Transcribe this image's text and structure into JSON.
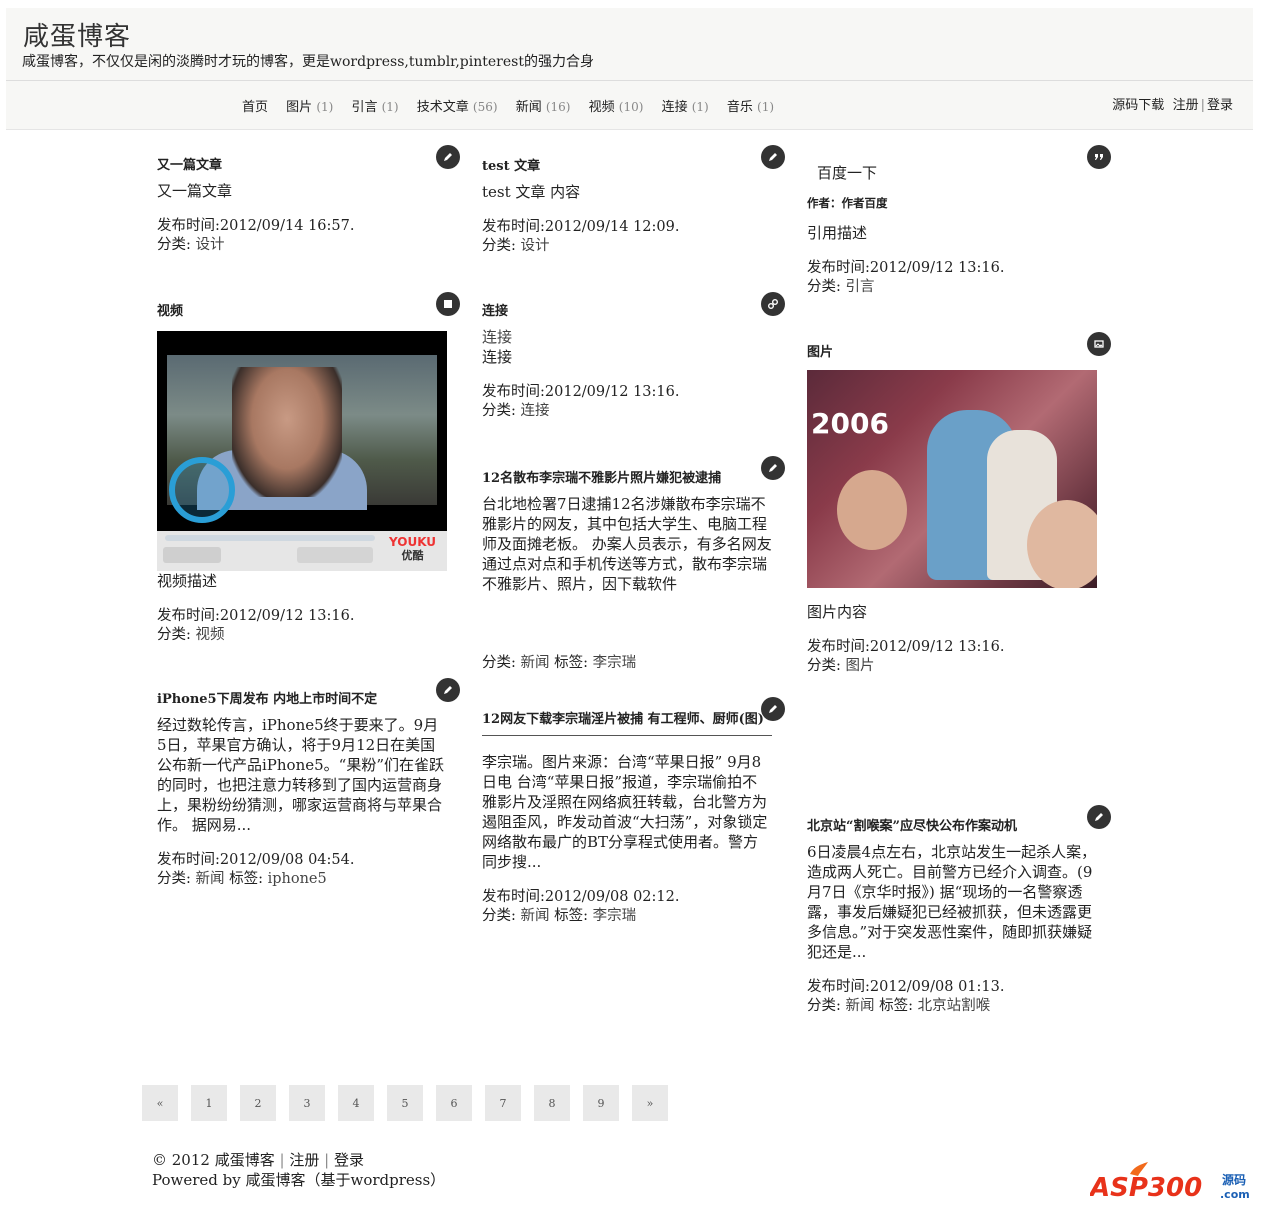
{
  "header": {
    "title": "咸蛋博客",
    "description": "咸蛋博客，不仅仅是闲的淡腾时才玩的博客，更是wordpress,tumblr,pinterest的强力合身"
  },
  "nav": {
    "items": [
      {
        "label": "首页",
        "count": ""
      },
      {
        "label": "图片",
        "count": "(1)"
      },
      {
        "label": "引言",
        "count": "(1)"
      },
      {
        "label": "技术文章",
        "count": "(56)"
      },
      {
        "label": "新闻",
        "count": "(16)"
      },
      {
        "label": "视频",
        "count": "(10)"
      },
      {
        "label": "连接",
        "count": "(1)"
      },
      {
        "label": "音乐",
        "count": "(1)"
      }
    ]
  },
  "usernav": {
    "download": "源码下载",
    "register": "注册",
    "separator": "|",
    "login": "登录"
  },
  "labels": {
    "published": "发布时间:",
    "category": "分类:",
    "tags": "标签:"
  },
  "posts": {
    "p1": {
      "title": "又一篇文章",
      "body": "又一篇文章",
      "date": "2012/09/14 16:57.",
      "category": "设计",
      "icon": "pencil-icon"
    },
    "p2": {
      "title": "test 文章",
      "body": "test 文章 内容",
      "date": "2012/09/14 12:09.",
      "category": "设计",
      "icon": "pencil-icon"
    },
    "p3": {
      "quote": "百度一下",
      "author": "作者：作者百度",
      "body": "引用描述",
      "date": "2012/09/12 13:16.",
      "category": "引言",
      "icon": "quote-icon"
    },
    "p4": {
      "title": "视频",
      "body": "视频描述",
      "date": "2012/09/12 13:16.",
      "category": "视频",
      "icon": "video-icon",
      "player_brand": "YOUKU",
      "player_brand_cn": "优酷"
    },
    "p5": {
      "title": "连接",
      "link1": "连接",
      "link2": "连接",
      "date": "2012/09/12 13:16.",
      "category": "连接",
      "icon": "link-icon"
    },
    "p6": {
      "title": "图片",
      "body": "图片内容",
      "date": "2012/09/12 13:16.",
      "category": "图片",
      "icon": "image-icon",
      "photo_text": "2006"
    },
    "p7": {
      "title": "12名散布李宗瑞不雅影片照片嫌犯被逮捕",
      "body": "台北地检署7日逮捕12名涉嫌散布李宗瑞不雅影片的网友，其中包括大学生、电脑工程师及面摊老板。 办案人员表示，有多名网友通过点对点和手机传送等方式，散布李宗瑞不雅影片、照片，因下载软件",
      "category": "新闻",
      "tag": "李宗瑞",
      "icon": "pencil-icon"
    },
    "p8": {
      "title": "iPhone5下周发布 内地上市时间不定",
      "body": "经过数轮传言，iPhone5终于要来了。9月5日，苹果官方确认，将于9月12日在美国公布新一代产品iPhone5。“果粉”们在雀跃的同时，也把注意力转移到了国内运营商身上，果粉纷纷猜测，哪家运营商将与苹果合作。 据网易...",
      "date": "2012/09/08 04:54.",
      "category": "新闻",
      "tag": "iphone5",
      "icon": "pencil-icon"
    },
    "p9": {
      "title": "12网友下载李宗瑞淫片被捕 有工程师、厨师(图)",
      "body": "李宗瑞。图片来源：台湾“苹果日报” 9月8日电 台湾“苹果日报”报道，李宗瑞偷拍不雅影片及淫照在网络疯狂转载，台北警方为遏阻歪风，昨发动首波“大扫荡”，对象锁定网络散布最广的BT分享程式使用者。警方同步搜...",
      "date": "2012/09/08 02:12.",
      "category": "新闻",
      "tag": "李宗瑞",
      "icon": "pencil-icon"
    },
    "p10": {
      "title": "北京站“割喉案”应尽快公布作案动机",
      "body": "6日凌晨4点左右，北京站发生一起杀人案，造成两人死亡。目前警方已经介入调查。(9月7日《京华时报》) 据“现场的一名警察透露，事发后嫌疑犯已经被抓获，但未透露更多信息。”对于突发恶性案件，随即抓获嫌疑犯还是...",
      "date": "2012/09/08 01:13.",
      "category": "新闻",
      "tag": "北京站割喉",
      "icon": "pencil-icon"
    }
  },
  "pager": [
    "«",
    "1",
    "2",
    "3",
    "4",
    "5",
    "6",
    "7",
    "8",
    "9",
    "»"
  ],
  "footer": {
    "copyright": "© 2012 咸蛋博客",
    "register": "注册",
    "login": "登录",
    "separator": "|",
    "powered": "Powered by 咸蛋博客（基于wordpress）"
  },
  "watermark": {
    "brand": "ASP300",
    "suffix": "源码",
    "domain": ".com"
  }
}
